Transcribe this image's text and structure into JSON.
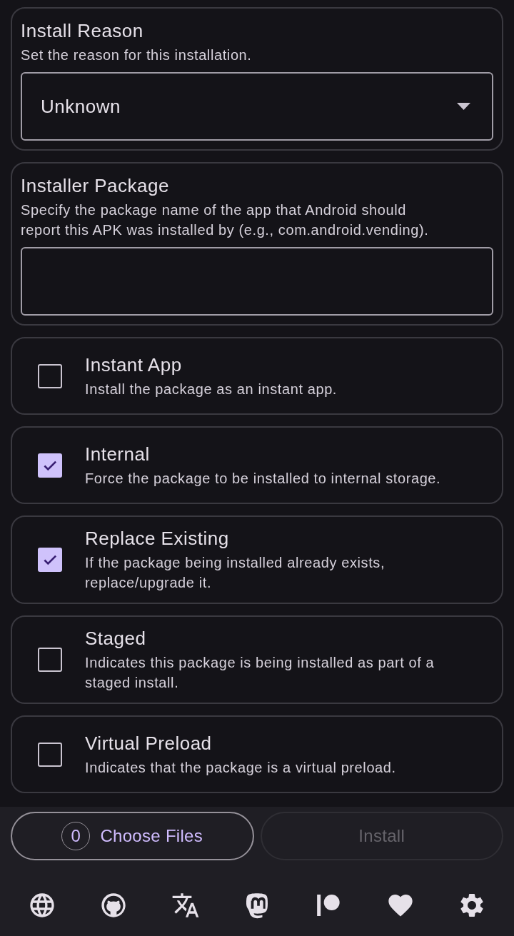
{
  "install_reason": {
    "title": "Install Reason",
    "description": "Set the reason for this installation.",
    "select": {
      "value": "Unknown"
    }
  },
  "installer_package": {
    "title": "Installer Package",
    "description": "Specify the package name of the app that Android should report this APK was installed by (e.g., com.android.vending)."
  },
  "options": [
    {
      "title": "Instant App",
      "description": "Install the package as an instant app.",
      "checked": false
    },
    {
      "title": "Internal",
      "description": "Force the package to be installed to internal storage.",
      "checked": true
    },
    {
      "title": "Replace Existing",
      "description": "If the package being installed already exists, replace/upgrade it.",
      "checked": true
    },
    {
      "title": "Staged",
      "description": "Indicates this package is being installed as part of a staged install.",
      "checked": false
    },
    {
      "title": "Virtual Preload",
      "description": "Indicates that the package is a virtual preload.",
      "checked": false
    }
  ],
  "actions": {
    "choose_files": {
      "count": "0",
      "label": "Choose Files"
    },
    "install": {
      "label": "Install",
      "disabled": true
    }
  },
  "footer_links": [
    {
      "kind": "globe"
    },
    {
      "kind": "cat"
    },
    {
      "kind": "translate"
    },
    {
      "kind": "mlogo"
    },
    {
      "kind": "circlebar"
    },
    {
      "kind": "heart"
    },
    {
      "kind": "gear"
    }
  ]
}
